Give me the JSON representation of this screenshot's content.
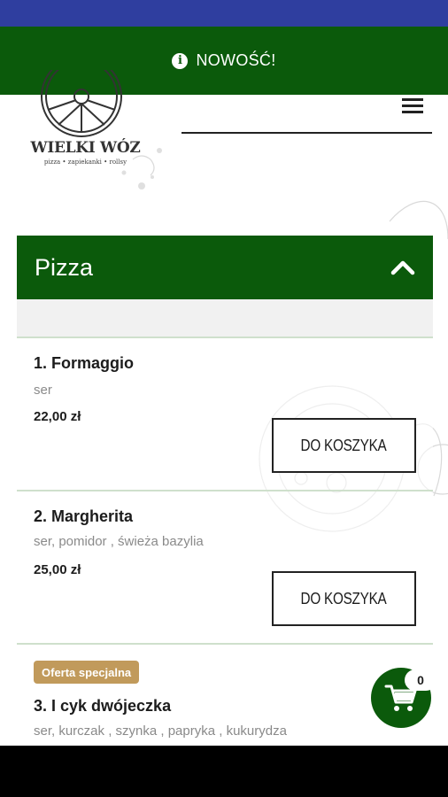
{
  "banner": {
    "text": "NOWOŚĆ!",
    "icon": "info-icon"
  },
  "logo": {
    "name": "WIELKI WÓZ",
    "tagline": "pizza • zapiekanki • rollsy"
  },
  "category": {
    "title": "Pizza",
    "icon": "chevron-up-icon"
  },
  "products": [
    {
      "name": "1. Formaggio",
      "description": "ser",
      "price": "22,00 zł",
      "button_label": "DO KOSZYKA"
    },
    {
      "name": "2. Margherita",
      "description": "ser, pomidor , świeża bazylia",
      "price": "25,00 zł",
      "button_label": "DO KOSZYKA"
    },
    {
      "badge": "Oferta specjalna",
      "name": "3. I cyk dwójeczka",
      "description": "ser, kurczak , szynka , papryka , kukurydza"
    }
  ],
  "cart": {
    "count": "0",
    "icon": "cart-icon"
  },
  "colors": {
    "brand_green": "#0b5a0b",
    "status_bar": "#2f3e9f",
    "badge_gold": "#c19a5b"
  }
}
